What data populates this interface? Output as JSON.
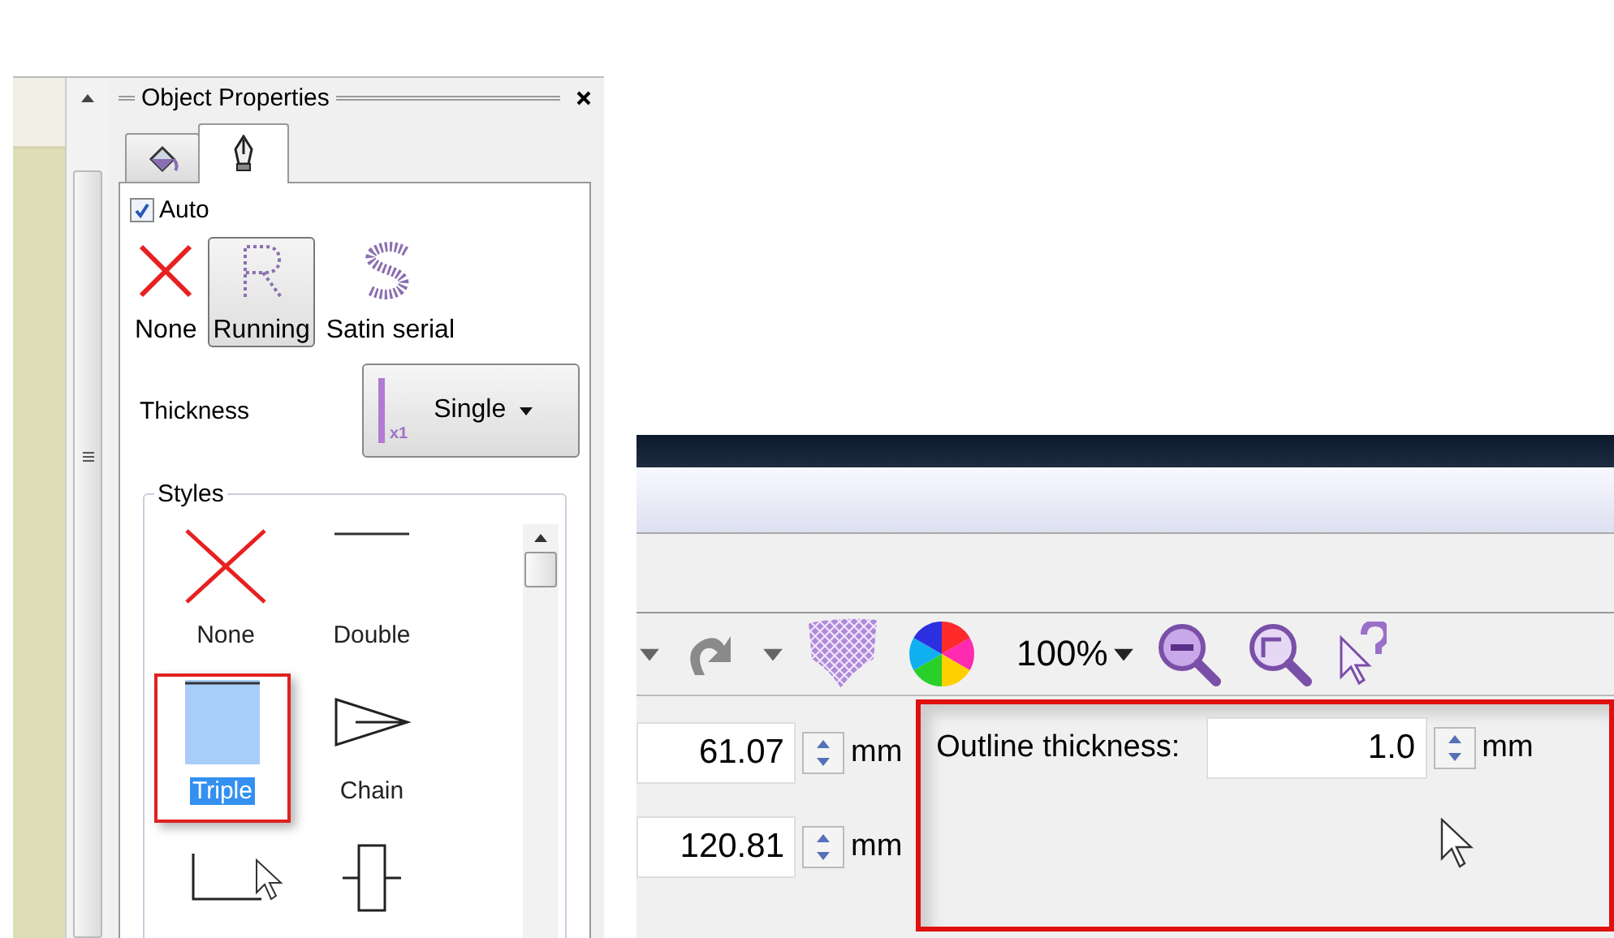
{
  "properties_panel": {
    "title": "Object Properties",
    "tabs": [
      {
        "kind": "fill",
        "selected": false
      },
      {
        "kind": "pen",
        "selected": true
      }
    ],
    "auto": {
      "label": "Auto",
      "checked": true
    },
    "outline_types": [
      {
        "kind": "none",
        "label": "None",
        "selected": false
      },
      {
        "kind": "running",
        "label": "Running",
        "selected": true
      },
      {
        "kind": "satin",
        "label": "Satin serial",
        "selected": false
      }
    ],
    "thickness": {
      "label": "Thickness",
      "badge": "x1",
      "value": "Single"
    },
    "styles": {
      "title": "Styles",
      "items": [
        {
          "kind": "none",
          "label": "None",
          "selected": false,
          "highlighted": false
        },
        {
          "kind": "double",
          "label": "Double",
          "selected": false,
          "highlighted": false
        },
        {
          "kind": "triple",
          "label": "Triple",
          "selected": true,
          "highlighted": true
        },
        {
          "kind": "chain",
          "label": "Chain",
          "selected": false,
          "highlighted": false
        },
        {
          "kind": "corner",
          "selected": false,
          "highlighted": false
        },
        {
          "kind": "box",
          "selected": false,
          "highlighted": false
        }
      ]
    }
  },
  "toolbar_panel": {
    "zoom": "100%",
    "fields": [
      {
        "value": "61.07",
        "unit": "mm"
      },
      {
        "value": "120.81",
        "unit": "mm"
      }
    ],
    "outline_thickness": {
      "label": "Outline thickness:",
      "value": "1.0",
      "unit": "mm",
      "highlighted": true
    }
  }
}
